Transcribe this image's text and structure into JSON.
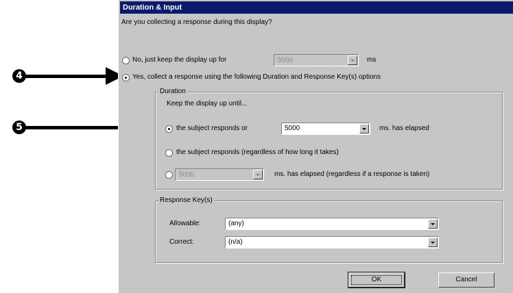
{
  "dialog": {
    "title": "Duration & Input",
    "question": "Are you collecting a response during this display?",
    "option_no": {
      "label": "No, just keep the display up for",
      "value": "5000",
      "unit": "ms",
      "selected": false
    },
    "option_yes": {
      "label": "Yes, collect a response using the following Duration and Response Key(s) options",
      "selected": true
    }
  },
  "duration_group": {
    "label": "Duration",
    "subtitle": "Keep the display up until...",
    "option1": {
      "label": "the subject responds or",
      "value": "5000",
      "unit": "ms. has elapsed",
      "selected": true
    },
    "option2": {
      "label": "the subject responds (regardless of how long it takes)",
      "selected": false
    },
    "option3": {
      "value": "5000",
      "label": "ms. has elapsed (regardless if a response is taken)",
      "selected": false
    }
  },
  "response_group": {
    "label": "Response Key(s)",
    "allowable_label": "Allowable:",
    "allowable_value": "(any)",
    "correct_label": "Correct:",
    "correct_value": "(n/a)"
  },
  "buttons": {
    "ok": "OK",
    "cancel": "Cancel"
  },
  "callouts": {
    "step4": "4",
    "step5": "5"
  }
}
